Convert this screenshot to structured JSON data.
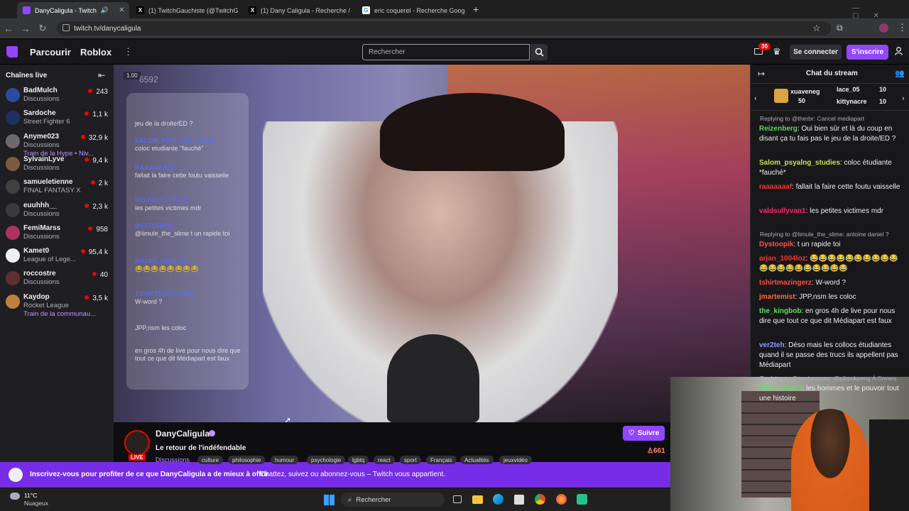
{
  "browser": {
    "tabs": [
      {
        "title": "DanyCaligula - Twitch",
        "icon": "twitch-icon",
        "active": true
      },
      {
        "title": "(1) TwitchGauchiste (@TwitchG",
        "icon": "x-icon",
        "active": false
      },
      {
        "title": "(1) Dany Caligula - Recherche /",
        "icon": "x-icon",
        "active": false
      },
      {
        "title": "eric coquerel - Recherche Goog",
        "icon": "google-icon",
        "active": false
      }
    ],
    "url": "twitch.tv/danycaligula"
  },
  "topnav": {
    "browse": "Parcourir",
    "game_link": "Roblox",
    "search_placeholder": "Rechercher",
    "notif_count": "30",
    "login": "Se connecter",
    "signup": "S'inscrire"
  },
  "sidebar": {
    "title": "Chaînes live",
    "channels": [
      {
        "name": "BadMulch",
        "game": "Discussions",
        "viewers": "243",
        "extra": "",
        "color": "#2b4a9b"
      },
      {
        "name": "Sardoche",
        "game": "Street Fighter 6",
        "viewers": "1,1 k",
        "extra": "",
        "color": "#1e3060"
      },
      {
        "name": "Anyme023",
        "game": "Discussions",
        "viewers": "32,9 k",
        "extra": "Train de la Hype • Niv...",
        "color": "#6a6a6a"
      },
      {
        "name": "SylvainLyve",
        "game": "Discussions",
        "viewers": "9,4 k",
        "extra": "",
        "color": "#7a5a40"
      },
      {
        "name": "samueletienne",
        "game": "FINAL FANTASY X",
        "viewers": "2 k",
        "extra": "",
        "color": "#404040"
      },
      {
        "name": "euuhhh__",
        "game": "Discussions",
        "viewers": "2,3 k",
        "extra": "",
        "color": "#3a3a3a"
      },
      {
        "name": "FemiMarss",
        "game": "Discussions",
        "viewers": "958",
        "extra": "",
        "color": "#b03060"
      },
      {
        "name": "Kamet0",
        "game": "League of Lege...",
        "viewers": "95,4 k",
        "extra": "",
        "color": "#f0f0f0"
      },
      {
        "name": "roccostre",
        "game": "Discussions",
        "viewers": "40",
        "extra": "",
        "color": "#603030"
      },
      {
        "name": "Kaydop",
        "game": "Rocket League",
        "viewers": "3,5 k",
        "extra": "Train de la communau...",
        "color": "#c08040"
      }
    ]
  },
  "video_overlay": {
    "counter": "6592",
    "counter_small": "1.00",
    "messages": [
      {
        "user": "",
        "text": "jeu de la droite/ED ?"
      },
      {
        "user": "SALOM_PSYLANG_STUDI",
        "text": "coloc etudiante \"fauché\""
      },
      {
        "user": "RAAAAAAAF",
        "text": "fallait la faire cette foutu vaisselle"
      },
      {
        "user": "VALDSULLYVAN1",
        "text": "les petites victimes mdr"
      },
      {
        "user": "DYSTOOPIK",
        "text": "@limule_the_slime t un rapide toi"
      },
      {
        "user": "ARJAN_1004LOZ",
        "text": "😂😂😂😂😂😂😂😂"
      },
      {
        "user": "TSHIRTMAZINGERZ",
        "text": "W-word ?"
      },
      {
        "user": "",
        "text": "JPP,nsm les coloc"
      },
      {
        "user": "",
        "text": "en gros 4h de live pour nous dire que tout ce que dit Médiapart est faux"
      }
    ]
  },
  "chat": {
    "title": "Chat du stream",
    "top_gifters": [
      {
        "name": "xuaveneg",
        "count": "50"
      },
      {
        "name": "lace_05",
        "count": "10"
      },
      {
        "name": "kittynacre",
        "count": "10"
      }
    ],
    "messages": [
      {
        "reply": "Replying to @therbr: Cancel mediapart",
        "user": "Reizenberg",
        "color": "#5fd35f",
        "text": "Oui bien sûr et là du coup en disant ça tu fais pas le jeu de la droite/ED ?"
      },
      {
        "reply": "",
        "user": "Salom_psyalng_studies",
        "color": "#c9e44b",
        "text": "coloc étudiante *fauché*"
      },
      {
        "reply": "",
        "user": "raaaaaaaf",
        "color": "#ff3030",
        "text": "fallait la faire cette foutu vaisselle"
      },
      {
        "reply": "",
        "user": "valdsullyvan1",
        "color": "#ff2a6d",
        "text": "les petites victimes mdr"
      },
      {
        "reply": "Replying to @limule_the_slime: antoine daniel ?",
        "user": "Dystoopik",
        "color": "#ff5050",
        "text": "t un rapide toi"
      },
      {
        "reply": "",
        "user": "arjan_1004loz",
        "color": "#ff3030",
        "text": "😂😂😂😂😂😂😂😂😂😂😂😂😂😂😂😂😂😂😂😂"
      },
      {
        "reply": "",
        "user": "tshirtmazingerz",
        "color": "#ff4a4a",
        "text": "W-word ?"
      },
      {
        "reply": "",
        "user": "jmartemist",
        "color": "#ff6a3d",
        "text": "JPP,nsm les coloc"
      },
      {
        "reply": "",
        "user": "the_kingbob",
        "color": "#5fe05f",
        "text": "en gros 4h de live pour nous dire que tout ce que dit Médiapart est faux"
      },
      {
        "reply": "",
        "user": "ver2teh",
        "color": "#8a9bff",
        "text": "Déso mais les collocs étudiantes quand il se passe des trucs ils appellent pas Médiapart"
      },
      {
        "reply": "Replying to @ouaiscosmo: @pikpokpeng À l'invers",
        "user": "PikPokPeNG",
        "color": "#5fe05f",
        "text": "les hommes et le pouvoir tout une histoire"
      }
    ]
  },
  "stream_info": {
    "streamer": "DanyCaligula",
    "title": "Le retour de l'indéfendable",
    "category": "Discussions",
    "live": "LIVE",
    "tags": [
      "culture",
      "philosophie",
      "humour",
      "psychologie",
      "lgbtq",
      "react",
      "sport",
      "Français",
      "Actualités",
      "jeuxvidéo"
    ],
    "follow": "Suivre",
    "viewers": "661"
  },
  "banner": {
    "bold": "Inscrivez-vous pour profiter de ce que DanyCaligula a de mieux à offrir",
    "text": "Chattez, suivez ou abonnez-vous – Twitch vous appartient."
  },
  "taskbar": {
    "temp": "11°C",
    "weather": "Nuageux",
    "search": "Rechercher"
  }
}
